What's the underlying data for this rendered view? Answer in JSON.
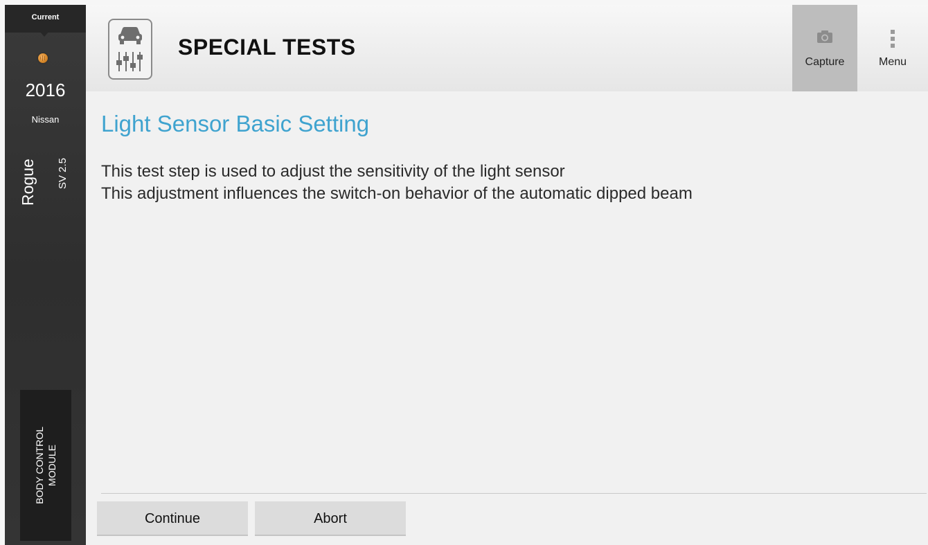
{
  "sidebar": {
    "current_label": "Current",
    "connector_icon": "obd-connector-icon",
    "year": "2016",
    "make": "Nissan",
    "model": "Rogue",
    "trim": "SV 2.5",
    "module_label": "BODY CONTROL\nMODULE"
  },
  "header": {
    "icon": "car-settings-icon",
    "title": "SPECIAL TESTS",
    "capture": {
      "icon": "camera-icon",
      "label": "Capture"
    },
    "menu": {
      "icon": "vertical-dots-icon",
      "label": "Menu"
    }
  },
  "main": {
    "title": "Light Sensor Basic Setting",
    "description": [
      "This test step is used to adjust the sensitivity of the light sensor",
      "This adjustment influences the switch-on behavior of the automatic dipped beam"
    ],
    "buttons": {
      "continue": "Continue",
      "abort": "Abort"
    }
  },
  "colors": {
    "accent": "#3fa3cf",
    "sidebar": "#333333",
    "capture_active": "#bdbdbd"
  }
}
